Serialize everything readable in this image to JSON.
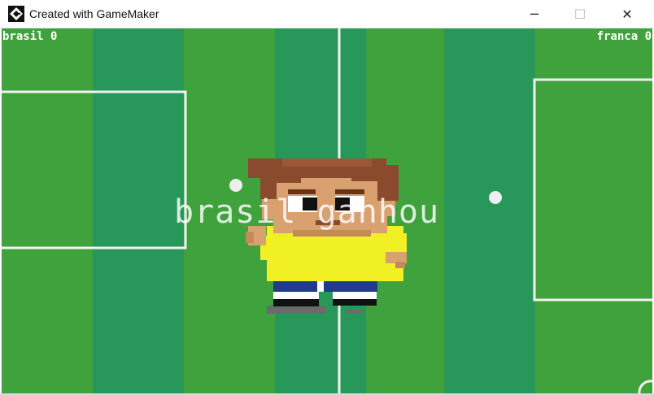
{
  "window": {
    "title": "Created with GameMaker",
    "buttons": {
      "minimize": "─",
      "maximize": "☐",
      "close": "✕"
    }
  },
  "hud": {
    "left_score": "brasil 0",
    "right_score": "franca 0"
  },
  "banner": {
    "text": "brasil ganhou"
  },
  "colors": {
    "stripe_light": "#3fa23c",
    "stripe_dark": "#27985a",
    "line": "#f2f2f2",
    "shirt": "#f0f024",
    "shorts": "#1f3a8f",
    "hair": "#8a4a2e",
    "skin": "#d9a070"
  },
  "icons": {
    "app": "gamemaker-logo-icon",
    "minimize": "minimize-icon",
    "maximize": "maximize-icon",
    "close": "close-icon"
  }
}
